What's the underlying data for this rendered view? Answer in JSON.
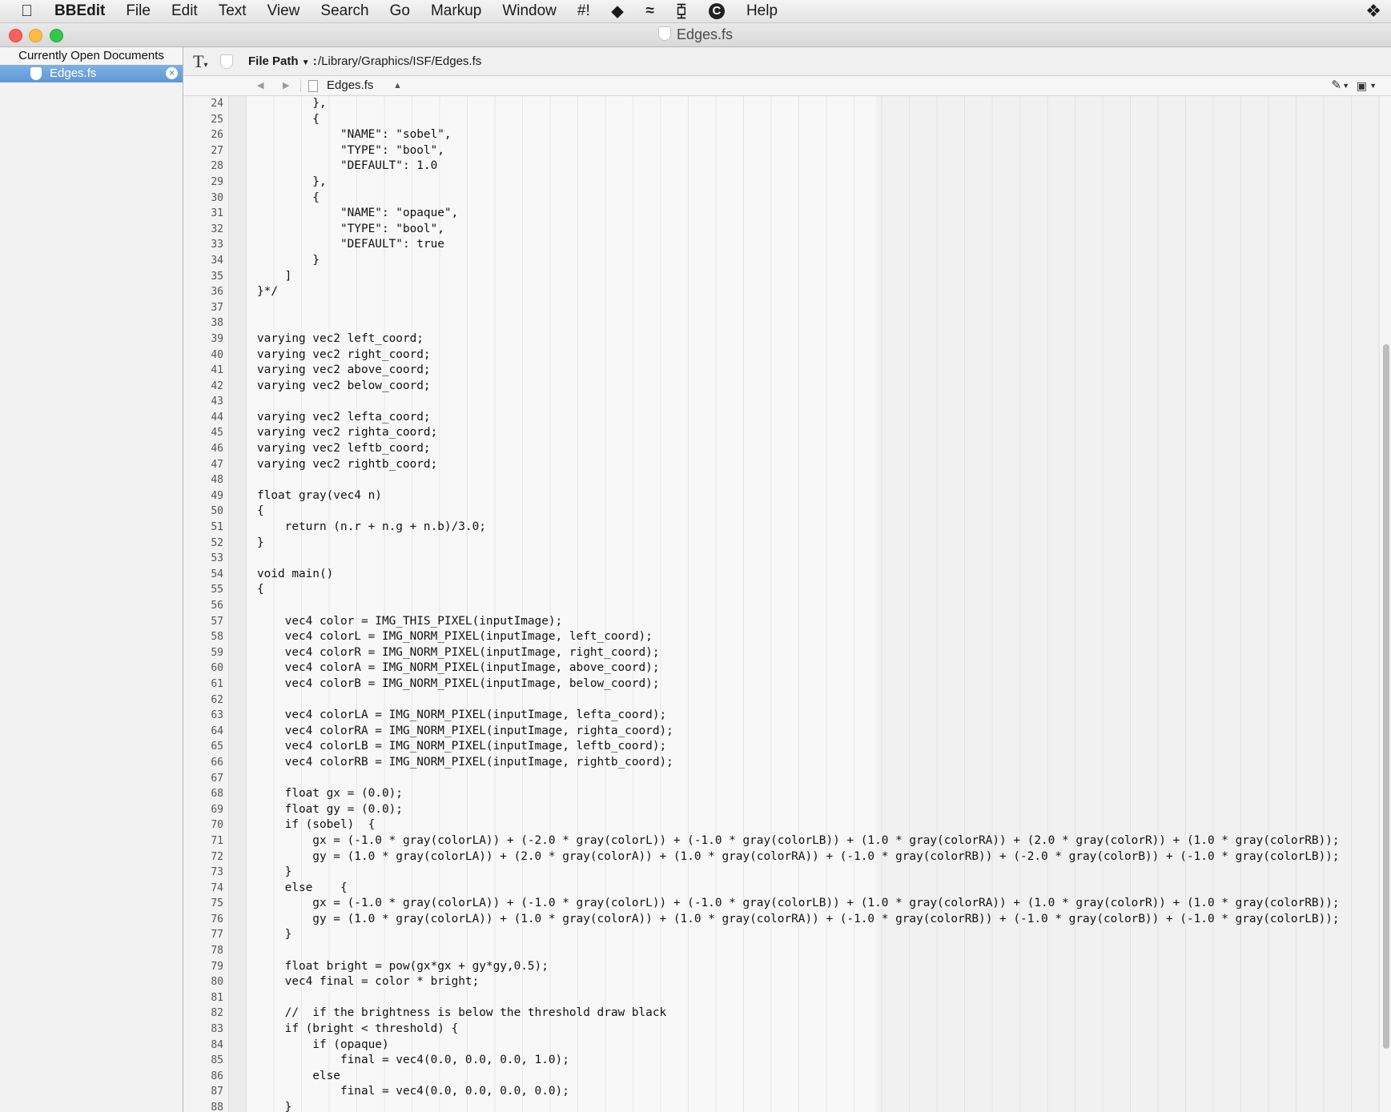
{
  "menubar": {
    "app_name": "BBEdit",
    "items": [
      "File",
      "Edit",
      "Text",
      "View",
      "Search",
      "Go",
      "Markup",
      "Window",
      "#!"
    ],
    "help": "Help"
  },
  "window": {
    "title": "Edges.fs"
  },
  "sidebar": {
    "header": "Currently Open Documents",
    "documents": [
      {
        "name": "Edges.fs"
      }
    ]
  },
  "pathbar": {
    "label": "File Path",
    "separator": ":",
    "value": "/Library/Graphics/ISF/Edges.fs"
  },
  "navbar": {
    "file_name": "Edges.fs"
  },
  "editor": {
    "lines": [
      {
        "n": "24",
        "text": "        },"
      },
      {
        "n": "25",
        "text": "        {"
      },
      {
        "n": "26",
        "text": "            \"NAME\": \"sobel\","
      },
      {
        "n": "27",
        "text": "            \"TYPE\": \"bool\","
      },
      {
        "n": "28",
        "text": "            \"DEFAULT\": 1.0"
      },
      {
        "n": "29",
        "text": "        },"
      },
      {
        "n": "30",
        "text": "        {"
      },
      {
        "n": "31",
        "text": "            \"NAME\": \"opaque\","
      },
      {
        "n": "32",
        "text": "            \"TYPE\": \"bool\","
      },
      {
        "n": "33",
        "text": "            \"DEFAULT\": true"
      },
      {
        "n": "34",
        "text": "        }"
      },
      {
        "n": "35",
        "text": "    ]"
      },
      {
        "n": "36",
        "text": "}*/"
      },
      {
        "n": "37",
        "text": ""
      },
      {
        "n": "38",
        "text": ""
      },
      {
        "n": "39",
        "text": "varying vec2 left_coord;"
      },
      {
        "n": "40",
        "text": "varying vec2 right_coord;"
      },
      {
        "n": "41",
        "text": "varying vec2 above_coord;"
      },
      {
        "n": "42",
        "text": "varying vec2 below_coord;"
      },
      {
        "n": "43",
        "text": ""
      },
      {
        "n": "44",
        "text": "varying vec2 lefta_coord;"
      },
      {
        "n": "45",
        "text": "varying vec2 righta_coord;"
      },
      {
        "n": "46",
        "text": "varying vec2 leftb_coord;"
      },
      {
        "n": "47",
        "text": "varying vec2 rightb_coord;"
      },
      {
        "n": "48",
        "text": ""
      },
      {
        "n": "49",
        "text": "float gray(vec4 n)"
      },
      {
        "n": "50",
        "text": "{"
      },
      {
        "n": "51",
        "text": "    return (n.r + n.g + n.b)/3.0;"
      },
      {
        "n": "52",
        "text": "}"
      },
      {
        "n": "53",
        "text": ""
      },
      {
        "n": "54",
        "text": "void main()"
      },
      {
        "n": "55",
        "text": "{"
      },
      {
        "n": "56",
        "text": ""
      },
      {
        "n": "57",
        "text": "    vec4 color = IMG_THIS_PIXEL(inputImage);"
      },
      {
        "n": "58",
        "text": "    vec4 colorL = IMG_NORM_PIXEL(inputImage, left_coord);"
      },
      {
        "n": "59",
        "text": "    vec4 colorR = IMG_NORM_PIXEL(inputImage, right_coord);"
      },
      {
        "n": "60",
        "text": "    vec4 colorA = IMG_NORM_PIXEL(inputImage, above_coord);"
      },
      {
        "n": "61",
        "text": "    vec4 colorB = IMG_NORM_PIXEL(inputImage, below_coord);"
      },
      {
        "n": "62",
        "text": ""
      },
      {
        "n": "63",
        "text": "    vec4 colorLA = IMG_NORM_PIXEL(inputImage, lefta_coord);"
      },
      {
        "n": "64",
        "text": "    vec4 colorRA = IMG_NORM_PIXEL(inputImage, righta_coord);"
      },
      {
        "n": "65",
        "text": "    vec4 colorLB = IMG_NORM_PIXEL(inputImage, leftb_coord);"
      },
      {
        "n": "66",
        "text": "    vec4 colorRB = IMG_NORM_PIXEL(inputImage, rightb_coord);"
      },
      {
        "n": "67",
        "text": ""
      },
      {
        "n": "68",
        "text": "    float gx = (0.0);"
      },
      {
        "n": "69",
        "text": "    float gy = (0.0);"
      },
      {
        "n": "70",
        "text": "    if (sobel)  {"
      },
      {
        "n": "71",
        "text": "        gx = (-1.0 * gray(colorLA)) + (-2.0 * gray(colorL)) + (-1.0 * gray(colorLB)) + (1.0 * gray(colorRA)) + (2.0 * gray(colorR)) + (1.0 * gray(colorRB));"
      },
      {
        "n": "72",
        "text": "        gy = (1.0 * gray(colorLA)) + (2.0 * gray(colorA)) + (1.0 * gray(colorRA)) + (-1.0 * gray(colorRB)) + (-2.0 * gray(colorB)) + (-1.0 * gray(colorLB));"
      },
      {
        "n": "73",
        "text": "    }"
      },
      {
        "n": "74",
        "text": "    else    {"
      },
      {
        "n": "75",
        "text": "        gx = (-1.0 * gray(colorLA)) + (-1.0 * gray(colorL)) + (-1.0 * gray(colorLB)) + (1.0 * gray(colorRA)) + (1.0 * gray(colorR)) + (1.0 * gray(colorRB));"
      },
      {
        "n": "76",
        "text": "        gy = (1.0 * gray(colorLA)) + (1.0 * gray(colorA)) + (1.0 * gray(colorRA)) + (-1.0 * gray(colorRB)) + (-1.0 * gray(colorB)) + (-1.0 * gray(colorLB));"
      },
      {
        "n": "77",
        "text": "    }"
      },
      {
        "n": "78",
        "text": ""
      },
      {
        "n": "79",
        "text": "    float bright = pow(gx*gx + gy*gy,0.5);"
      },
      {
        "n": "80",
        "text": "    vec4 final = color * bright;"
      },
      {
        "n": "81",
        "text": ""
      },
      {
        "n": "82",
        "text": "    //  if the brightness is below the threshold draw black"
      },
      {
        "n": "83",
        "text": "    if (bright < threshold) {"
      },
      {
        "n": "84",
        "text": "        if (opaque)"
      },
      {
        "n": "85",
        "text": "            final = vec4(0.0, 0.0, 0.0, 1.0);"
      },
      {
        "n": "86",
        "text": "        else"
      },
      {
        "n": "87",
        "text": "            final = vec4(0.0, 0.0, 0.0, 0.0);"
      },
      {
        "n": "88",
        "text": "    }"
      }
    ]
  }
}
